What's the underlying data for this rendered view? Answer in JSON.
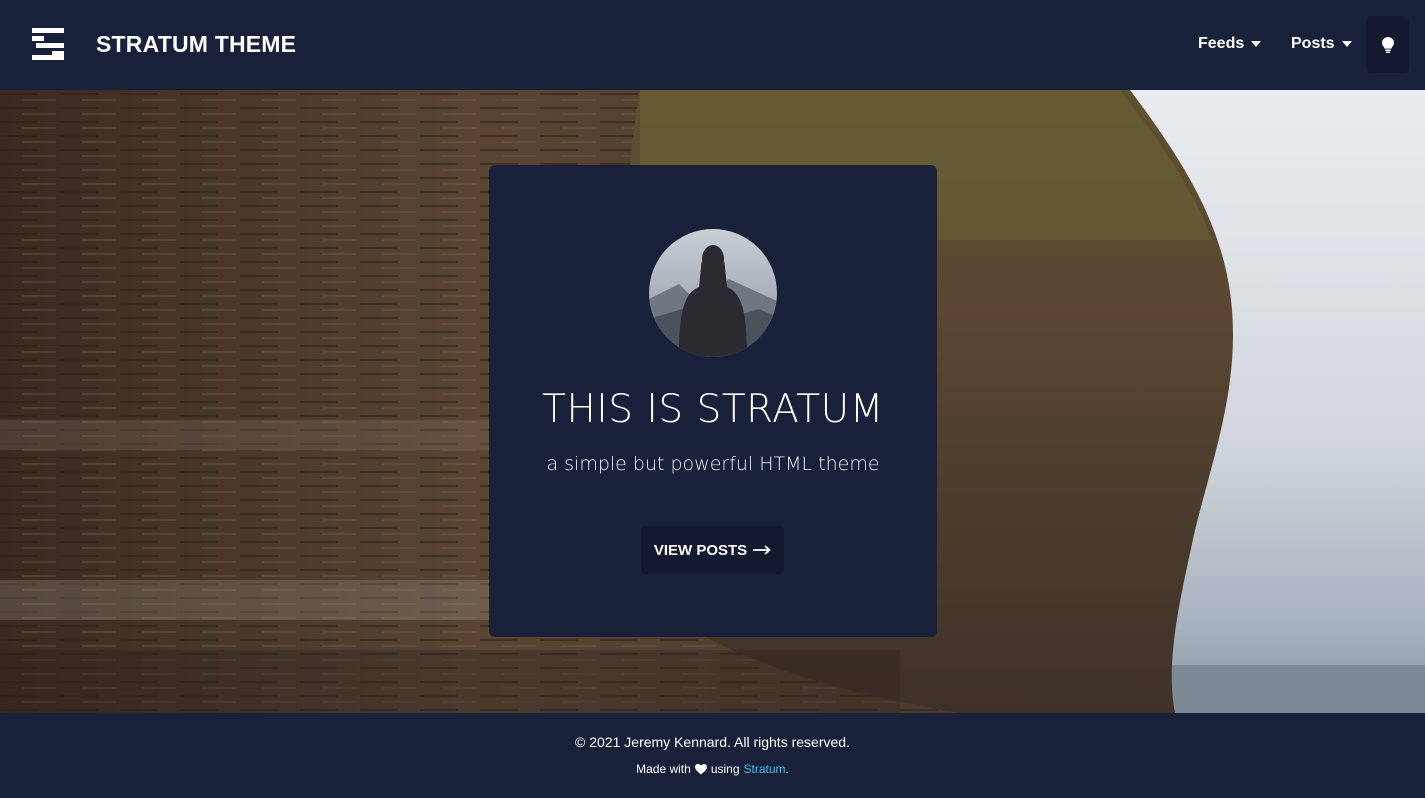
{
  "colors": {
    "navy": "#192039",
    "button_bg": "#131a30",
    "link": "#3bc4ea"
  },
  "navbar": {
    "logo_icon": "stratum-logo-icon",
    "brand": "STRATUM THEME",
    "items": [
      {
        "label": "Feeds",
        "icon": "caret-down-icon"
      },
      {
        "label": "Posts",
        "icon": "caret-down-icon"
      }
    ],
    "theme_toggle_icon": "lightbulb-icon"
  },
  "hero": {
    "background": "rock-cliff-photo",
    "card": {
      "avatar": "hooded-figure-avatar",
      "title": "THIS IS STRATUM",
      "subtitle": "a simple but powerful HTML theme",
      "cta_label": "VIEW POSTS",
      "cta_icon": "arrow-right-icon"
    }
  },
  "footer": {
    "copyright": "© 2021 Jeremy Kennard. All rights reserved.",
    "made_with_prefix": "Made with",
    "heart_icon": "heart-icon",
    "using_text": "using",
    "link_text": "Stratum",
    "suffix": "."
  }
}
